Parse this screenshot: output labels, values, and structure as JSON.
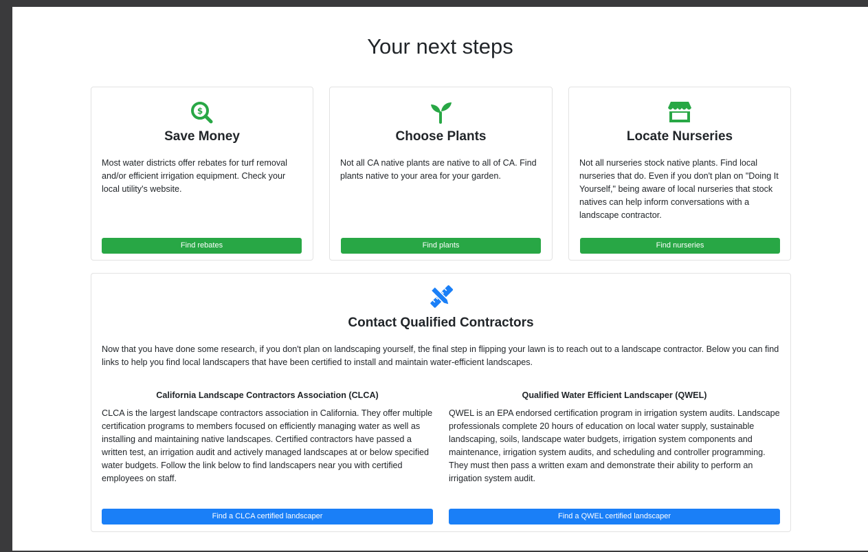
{
  "page": {
    "title": "Your next steps"
  },
  "cards": [
    {
      "title": "Save Money",
      "text": "Most water districts offer rebates for turf removal and/or efficient irrigation equipment. Check your local utility's website.",
      "button": "Find rebates",
      "icon": "search-dollar-icon"
    },
    {
      "title": "Choose Plants",
      "text": "Not all CA native plants are native to all of CA. Find plants native to your area for your garden.",
      "button": "Find plants",
      "icon": "seedling-icon"
    },
    {
      "title": "Locate Nurseries",
      "text": "Not all nurseries stock native plants. Find local nurseries that do. Even if you don't plan on \"Doing It Yourself,\" being aware of local nurseries that stock natives can help inform conversations with a landscape contractor.",
      "button": "Find nurseries",
      "icon": "store-icon"
    }
  ],
  "contractors": {
    "title": "Contact Qualified Contractors",
    "icon": "drafting-tools-icon",
    "intro": "Now that you have done some research, if you don't plan on landscaping yourself, the final step in flipping your lawn is to reach out to a landscape contractor. Below you can find links to help you find local landscapers that have been certified to install and maintain water-efficient landscapes.",
    "clca": {
      "title": "California Landscape Contractors Association (CLCA)",
      "text": "CLCA is the largest landscape contractors association in California. They offer multiple certification programs to members focused on efficiently managing water as well as installing and maintaining native landscapes. Certified contractors have passed a written test, an irrigation audit and actively managed landscapes at or below specified water budgets. Follow the link below to find landscapers near you with certified employees on staff.",
      "button": "Find a CLCA certified landscaper"
    },
    "qwel": {
      "title": "Qualified Water Efficient Landscaper (QWEL)",
      "text": "QWEL is an EPA endorsed certification program in irrigation system audits. Landscape professionals complete 20 hours of education on local water supply, sustainable landscaping, soils, landscape water budgets, irrigation system components and maintenance, irrigation system audits, and scheduling and controller programming. They must then pass a written exam and demonstrate their ability to perform an irrigation system audit.",
      "button": "Find a QWEL certified landscaper"
    }
  },
  "colors": {
    "green": "#28a745",
    "blue": "#1a7ff7"
  }
}
